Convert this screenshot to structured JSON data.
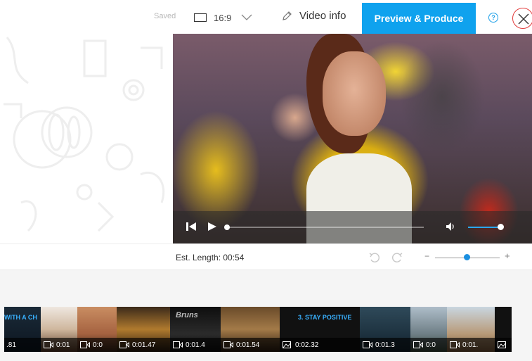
{
  "header": {
    "saved_label": "Saved",
    "aspect_ratio": "16:9",
    "video_info_label": "Video info",
    "preview_label": "Preview & Produce",
    "help_symbol": "?",
    "accent_color": "#0fa2ee",
    "close_color": "#e23b3b"
  },
  "player": {
    "progress_fraction": 0.0,
    "volume_fraction": 1.0
  },
  "toolbar": {
    "est_length": "Est. Length: 00:54",
    "zoom_minus": "−",
    "zoom_plus": "+",
    "zoom_fraction": 0.5
  },
  "timeline": {
    "clips": [
      {
        "time": ".81",
        "kind": "video",
        "overlay": "WITH A CH"
      },
      {
        "time": "0:01",
        "kind": "video"
      },
      {
        "time": "0:0",
        "kind": "video"
      },
      {
        "time": "0:01.47",
        "kind": "video"
      },
      {
        "time": "0:01.4",
        "kind": "video",
        "overlay": "Bruns"
      },
      {
        "time": "0:01.54",
        "kind": "video"
      },
      {
        "time": "0:02.32",
        "kind": "image",
        "overlay": "3. STAY POSITIVE"
      },
      {
        "time": "0:01.3",
        "kind": "video"
      },
      {
        "time": "0:0",
        "kind": "video"
      },
      {
        "time": "0:01.",
        "kind": "video"
      },
      {
        "time": "",
        "kind": "image"
      }
    ]
  }
}
